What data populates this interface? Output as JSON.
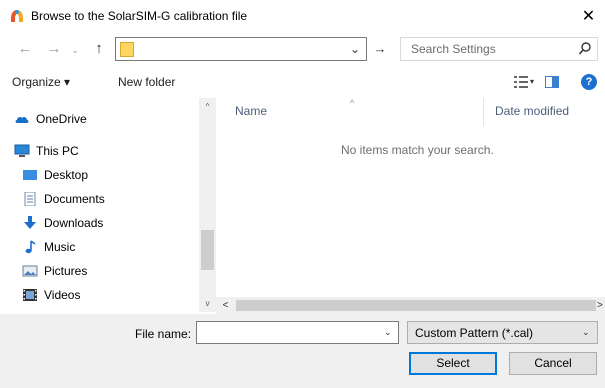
{
  "window": {
    "title": "Browse to the SolarSIM-G calibration file",
    "close_glyph": "✕",
    "app_icon": "solarsim-app-icon"
  },
  "address_bar": {
    "back_glyph": "←",
    "forward_glyph": "→",
    "recent_glyph": "⌄",
    "up_glyph": "↑",
    "path_value": "",
    "dropdown_glyph": "⌄",
    "go_glyph": "→",
    "folder_icon": "folder-icon"
  },
  "search": {
    "placeholder": "Search Settings",
    "icon": "search-icon"
  },
  "toolbar": {
    "organize_label": "Organize ▾",
    "new_folder_label": "New folder",
    "view_chevron": "▾",
    "help_glyph": "?"
  },
  "nav_pane": {
    "items": [
      {
        "label": "OneDrive",
        "icon": "onedrive-icon"
      },
      {
        "label": "This PC",
        "icon": "this-pc-icon"
      },
      {
        "label": "Desktop",
        "icon": "desktop-icon"
      },
      {
        "label": "Documents",
        "icon": "documents-icon"
      },
      {
        "label": "Downloads",
        "icon": "downloads-icon"
      },
      {
        "label": "Music",
        "icon": "music-icon"
      },
      {
        "label": "Pictures",
        "icon": "pictures-icon"
      },
      {
        "label": "Videos",
        "icon": "videos-icon"
      }
    ],
    "scroll_up_glyph": "^",
    "scroll_down_glyph": "v"
  },
  "file_list": {
    "columns": [
      "Name",
      "Date modified"
    ],
    "sort_glyph": "^",
    "empty_message": "No items match your search.",
    "scroll_left_glyph": "<",
    "scroll_right_glyph": ">"
  },
  "footer": {
    "filename_label": "File name:",
    "filename_value": "",
    "filename_chevron": "⌄",
    "filter_value": "Custom Pattern (*.cal)",
    "filter_chevron": "⌄",
    "select_label": "Select",
    "cancel_label": "Cancel"
  },
  "colors": {
    "accent": "#0078d7",
    "folder": "#ffd75e",
    "help": "#1c6fd0",
    "column_header_text": "#4c607a"
  }
}
